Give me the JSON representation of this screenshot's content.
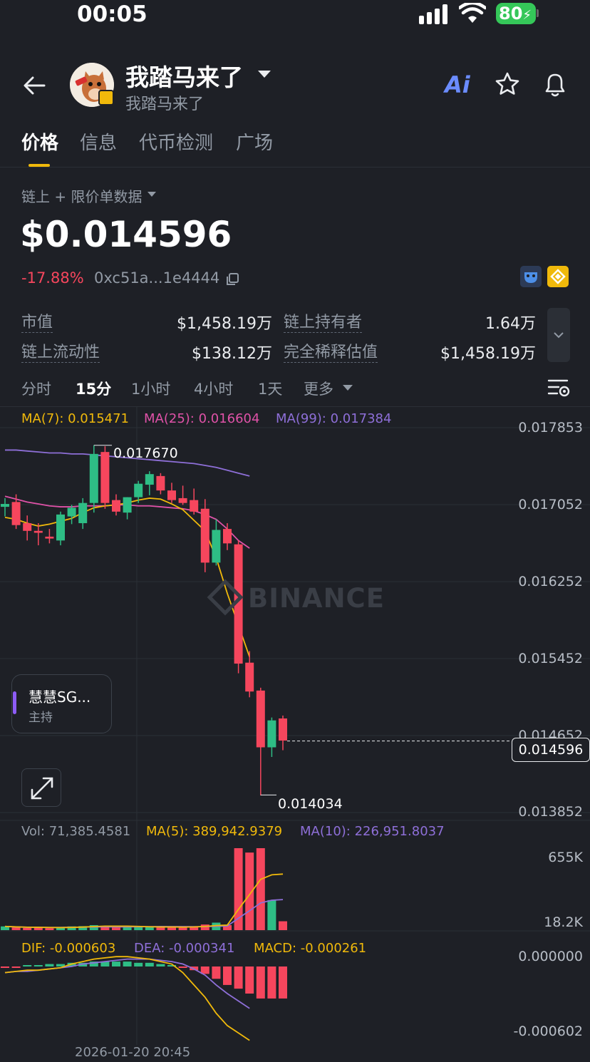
{
  "status_bar": {
    "time": "00:05",
    "battery": "80"
  },
  "header": {
    "title": "我踏马来了",
    "subtitle": "我踏马来了",
    "ai_label": "Ai"
  },
  "tabs": [
    "价格",
    "信息",
    "代币检测",
    "广场"
  ],
  "price_section": {
    "source_label": "链上 + 限价单数据",
    "price": "$0.014596",
    "change": "-17.88%",
    "contract": "0xc51a...1e4444"
  },
  "stats": {
    "market_cap_label": "市值",
    "market_cap": "$1,458.19万",
    "holders_label": "链上持有者",
    "holders": "1.64万",
    "liquidity_label": "链上流动性",
    "liquidity": "$138.12万",
    "fdv_label": "完全稀释估值",
    "fdv": "$1,458.19万"
  },
  "timeframes": [
    "分时",
    "15分",
    "1小时",
    "4小时",
    "1天",
    "更多"
  ],
  "chart": {
    "ma7": "MA(7): 0.015471",
    "ma25": "MA(25): 0.016604",
    "ma99": "MA(99): 0.017384",
    "price_axis": [
      "0.017853",
      "0.017052",
      "0.016252",
      "0.015452",
      "0.014652",
      "0.013852"
    ],
    "current_price_tag": "0.014596",
    "high_label": "0.017670",
    "low_label": "0.014034",
    "watermark": "BINANCE",
    "host_name": "慧慧SG...",
    "host_role": "主持",
    "vol_legend": "Vol: 71,385.4581",
    "vol_ma5": "MA(5): 389,942.9379",
    "vol_ma10": "MA(10): 226,951.8037",
    "vol_axis": [
      "655K",
      "18.2K"
    ],
    "dif": "DIF: -0.000603",
    "dea": "DEA: -0.000341",
    "macd": "MACD: -0.000261",
    "macd_axis": [
      "0.000000",
      "-0.000602"
    ],
    "date_label": "2026-01-20 20:45"
  },
  "colors": {
    "up": "#2ebd85",
    "down": "#f6465d",
    "accent": "#f0b90b",
    "ma7": "#f0b90b",
    "ma25": "#e052a8",
    "ma99": "#8e6fd8"
  },
  "chart_data": {
    "type": "candlestick",
    "candles": [
      {
        "o": 0.01703,
        "h": 0.01712,
        "l": 0.01693,
        "c": 0.01706
      },
      {
        "o": 0.01708,
        "h": 0.01716,
        "l": 0.0168,
        "c": 0.01684
      },
      {
        "o": 0.01686,
        "h": 0.01694,
        "l": 0.01668,
        "c": 0.01678
      },
      {
        "o": 0.01678,
        "h": 0.01686,
        "l": 0.01663,
        "c": 0.01676
      },
      {
        "o": 0.01672,
        "h": 0.0168,
        "l": 0.01665,
        "c": 0.0167
      },
      {
        "o": 0.01668,
        "h": 0.01698,
        "l": 0.01663,
        "c": 0.01695
      },
      {
        "o": 0.01693,
        "h": 0.01705,
        "l": 0.01685,
        "c": 0.01702
      },
      {
        "o": 0.01686,
        "h": 0.01712,
        "l": 0.0168,
        "c": 0.01707
      },
      {
        "o": 0.01707,
        "h": 0.01767,
        "l": 0.01697,
        "c": 0.01758
      },
      {
        "o": 0.0176,
        "h": 0.01766,
        "l": 0.01701,
        "c": 0.01707
      },
      {
        "o": 0.0171,
        "h": 0.01716,
        "l": 0.01694,
        "c": 0.01698
      },
      {
        "o": 0.01697,
        "h": 0.01713,
        "l": 0.0169,
        "c": 0.01713
      },
      {
        "o": 0.01713,
        "h": 0.0173,
        "l": 0.01707,
        "c": 0.01727
      },
      {
        "o": 0.01726,
        "h": 0.0174,
        "l": 0.01715,
        "c": 0.01737
      },
      {
        "o": 0.01735,
        "h": 0.01738,
        "l": 0.01716,
        "c": 0.0172
      },
      {
        "o": 0.0172,
        "h": 0.01728,
        "l": 0.01707,
        "c": 0.0171
      },
      {
        "o": 0.01712,
        "h": 0.01725,
        "l": 0.01705,
        "c": 0.01707
      },
      {
        "o": 0.0171,
        "h": 0.01722,
        "l": 0.01695,
        "c": 0.01698
      },
      {
        "o": 0.01701,
        "h": 0.01711,
        "l": 0.01635,
        "c": 0.01645
      },
      {
        "o": 0.01645,
        "h": 0.0169,
        "l": 0.01642,
        "c": 0.01679
      },
      {
        "o": 0.0168,
        "h": 0.01686,
        "l": 0.01658,
        "c": 0.01665
      },
      {
        "o": 0.01664,
        "h": 0.01668,
        "l": 0.0153,
        "c": 0.0154
      },
      {
        "o": 0.01541,
        "h": 0.01553,
        "l": 0.01505,
        "c": 0.01511
      },
      {
        "o": 0.01512,
        "h": 0.01515,
        "l": 0.01403,
        "c": 0.01453
      },
      {
        "o": 0.01453,
        "h": 0.01484,
        "l": 0.01443,
        "c": 0.01481
      },
      {
        "o": 0.01483,
        "h": 0.01486,
        "l": 0.0145,
        "c": 0.0146
      }
    ],
    "ma7": [
      0.01692,
      0.0169,
      0.01686,
      0.01683,
      0.01685,
      0.01688,
      0.01691,
      0.01697,
      0.01702,
      0.01704,
      0.01705,
      0.01707,
      0.0171,
      0.01712,
      0.01711,
      0.01706,
      0.017,
      0.01689,
      0.01678,
      0.0165,
      0.01613,
      0.0158,
      0.01547
    ],
    "ma25": [
      0.01714,
      0.01711,
      0.01708,
      0.01706,
      0.01704,
      0.01703,
      0.01703,
      0.01704,
      0.01704,
      0.01704,
      0.01705,
      0.01705,
      0.01704,
      0.01704,
      0.01703,
      0.01702,
      0.01701,
      0.01699,
      0.01695,
      0.0169,
      0.0168,
      0.01668,
      0.0166
    ],
    "ma99": [
      0.01762,
      0.01762,
      0.01761,
      0.0176,
      0.01759,
      0.01759,
      0.01758,
      0.01758,
      0.01757,
      0.01756,
      0.01755,
      0.01754,
      0.01753,
      0.01752,
      0.01751,
      0.0175,
      0.01749,
      0.01748,
      0.01746,
      0.01744,
      0.01741,
      0.01738,
      0.01735
    ],
    "volume": [
      30,
      22,
      18,
      20,
      16,
      25,
      30,
      32,
      40,
      34,
      22,
      30,
      24,
      26,
      24,
      22,
      26,
      30,
      45,
      60,
      40,
      655,
      620,
      655,
      240,
      71
    ],
    "dif": [
      -5e-05,
      -4e-05,
      -3e-05,
      -3e-05,
      -2e-05,
      -1e-05,
      2e-05,
      4e-05,
      6e-05,
      7e-05,
      8e-05,
      8e-05,
      7e-05,
      6e-05,
      4e-05,
      2e-05,
      -5e-05,
      -0.00015,
      -0.00025,
      -0.00038,
      -0.00048,
      -0.00054,
      -0.0006
    ],
    "dea": [
      -5e-05,
      -4e-05,
      -4e-05,
      -3e-05,
      -2e-05,
      -1e-05,
      0.0,
      2e-05,
      3e-05,
      4e-05,
      5e-05,
      6e-05,
      6e-05,
      6e-05,
      5e-05,
      4e-05,
      2e-05,
      -2e-05,
      -7e-05,
      -0.00015,
      -0.00022,
      -0.00028,
      -0.00034
    ],
    "macd_hist": [
      -1e-05,
      -1e-05,
      1e-05,
      1e-05,
      2e-05,
      2e-05,
      3e-05,
      3e-05,
      4e-05,
      4e-05,
      4e-05,
      4e-05,
      3e-05,
      3e-05,
      2e-05,
      1e-05,
      -1e-05,
      -3e-05,
      -6e-05,
      -0.0001,
      -0.00015,
      -0.00018,
      -0.00022,
      -0.00026,
      -0.00026,
      -0.00026
    ],
    "price_range": [
      0.013852,
      0.017853
    ],
    "high": 0.01767,
    "low": 0.014034,
    "current": 0.014596
  }
}
